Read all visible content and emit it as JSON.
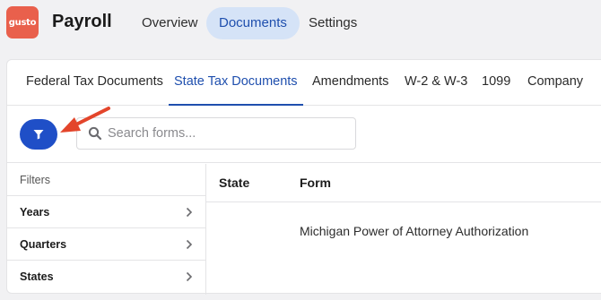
{
  "app": {
    "logo_text": "gusto",
    "title": "Payroll",
    "brand_color": "#e9604c"
  },
  "top_nav": {
    "items": [
      {
        "label": "Overview",
        "active": false
      },
      {
        "label": "Documents",
        "active": true
      },
      {
        "label": "Settings",
        "active": false
      }
    ]
  },
  "tabs": [
    {
      "label": "Federal Tax Documents",
      "active": false
    },
    {
      "label": "State Tax Documents",
      "active": true
    },
    {
      "label": "Amendments",
      "active": false
    },
    {
      "label": "W-2 & W-3",
      "active": false
    },
    {
      "label": "1099",
      "active": false
    },
    {
      "label": "Company",
      "active": false
    }
  ],
  "toolbar": {
    "filter_icon": "filter-funnel-icon",
    "search_icon": "search-icon",
    "search_placeholder": "Search forms...",
    "search_value": ""
  },
  "annotation": {
    "arrow_color": "#e3452b"
  },
  "filters": {
    "header": "Filters",
    "items": [
      {
        "label": "Years"
      },
      {
        "label": "Quarters"
      },
      {
        "label": "States"
      }
    ]
  },
  "table": {
    "columns": [
      "State",
      "Form"
    ],
    "rows": [
      {
        "state": "",
        "form": "Michigan Power of Attorney Authorization"
      }
    ]
  },
  "colors": {
    "accent": "#1f4fc7",
    "active_tab_text": "#1f4fae",
    "active_nav_bg": "#d5e3f7"
  }
}
